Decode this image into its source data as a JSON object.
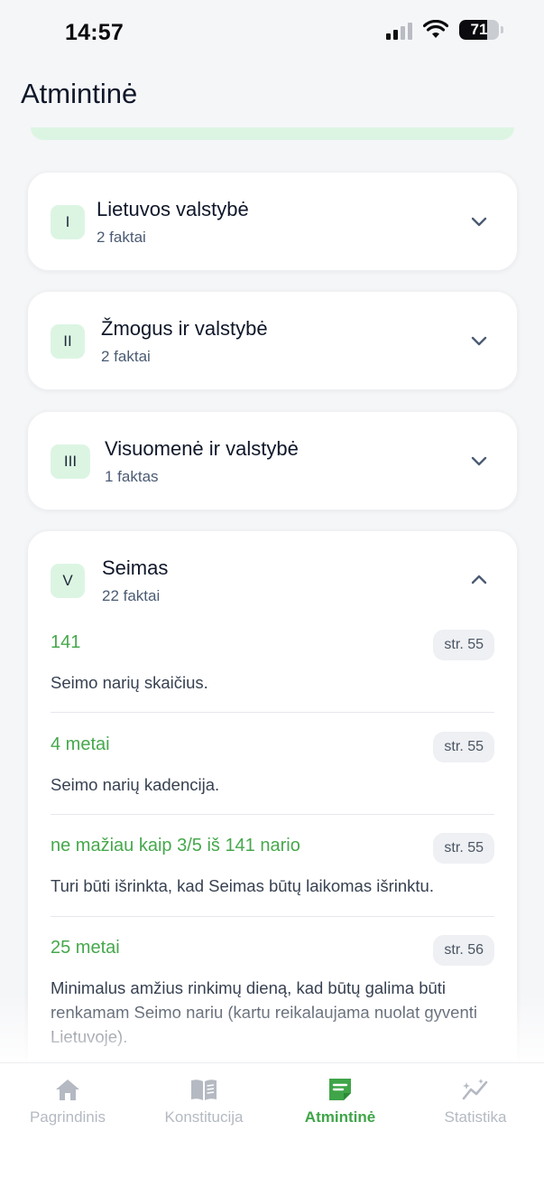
{
  "status_bar": {
    "time": "14:57",
    "battery": "71"
  },
  "header": {
    "title": "Atmintinė"
  },
  "sections": [
    {
      "roman": "I",
      "title": "Lietuvos valstybė",
      "count": "2 faktai"
    },
    {
      "roman": "II",
      "title": "Žmogus ir valstybė",
      "count": "2 faktai"
    },
    {
      "roman": "III",
      "title": "Visuomenė ir valstybė",
      "count": "1 faktas"
    },
    {
      "roman": "V",
      "title": "Seimas",
      "count": "22 faktai"
    }
  ],
  "facts": [
    {
      "value": "141",
      "ref": "str. 55",
      "desc": "Seimo narių skaičius."
    },
    {
      "value": "4 metai",
      "ref": "str. 55",
      "desc": "Seimo narių kadencija."
    },
    {
      "value": "ne mažiau kaip 3/5 iš 141 nario",
      "ref": "str. 55",
      "desc": "Turi būti išrinkta, kad Seimas būtų laikomas išrinktu."
    },
    {
      "value": "25 metai",
      "ref": "str. 56",
      "desc": "Minimalus amžius rinkimų dieną, kad būtų galima būti renkamam Seimo nariu (kartu reikalaujama nuolat gyventi Lietuvoje)."
    }
  ],
  "tabs": [
    {
      "label": "Pagrindinis",
      "icon": "home-icon"
    },
    {
      "label": "Konstitucija",
      "icon": "book-icon"
    },
    {
      "label": "Atmintinė",
      "icon": "note-icon",
      "active": true
    },
    {
      "label": "Statistika",
      "icon": "chart-icon"
    }
  ],
  "colors": {
    "accent": "#3fa548",
    "badge_bg": "#dcf5e3",
    "inactive": "#b4b9c2"
  }
}
